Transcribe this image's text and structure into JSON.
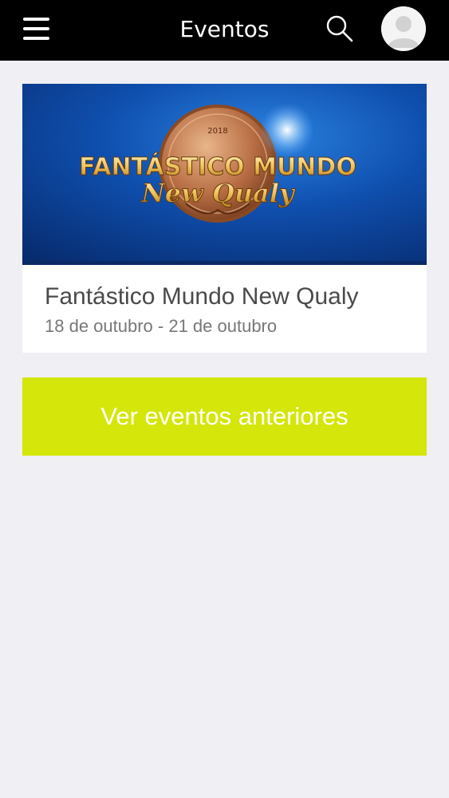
{
  "header": {
    "title": "Eventos",
    "menu_icon": "hamburger-icon",
    "search_icon": "search-icon",
    "avatar_icon": "user-avatar-icon"
  },
  "events": [
    {
      "banner": {
        "line1": "FANTÁSTICO MUNDO",
        "line2": "New Qualy",
        "year": "2018"
      },
      "title": "Fantástico Mundo New Qualy",
      "dates": "18 de outubro - 21 de outubro"
    }
  ],
  "past_events_button": "Ver eventos anteriores",
  "colors": {
    "topbar": "#000000",
    "background": "#efeff4",
    "accent_button": "#d4e60a",
    "banner_blue": "#0b3a8c"
  }
}
